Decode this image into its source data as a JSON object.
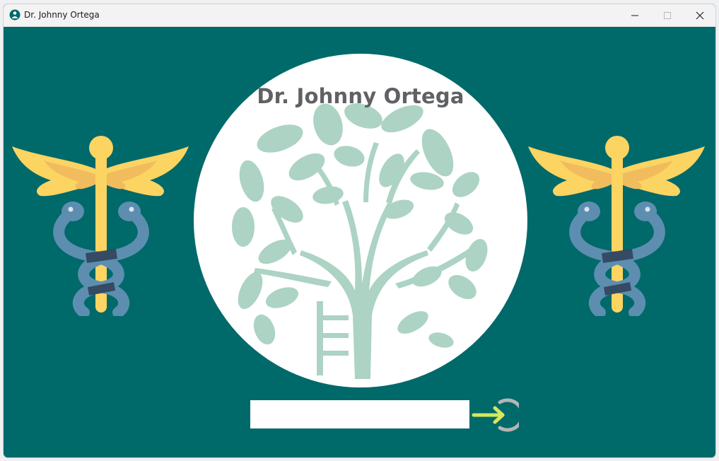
{
  "window": {
    "title": "Dr. Johnny Ortega",
    "controls": [
      "minimize",
      "maximize",
      "close"
    ]
  },
  "main": {
    "doctor_name": "Dr. Johnny Ortega",
    "password_field": {
      "value": "",
      "placeholder": ""
    },
    "login_button_icon": "arrow-right-circle-icon",
    "left_emblem_icon": "caduceus-icon",
    "right_emblem_icon": "caduceus-icon",
    "logo_icon": "tree-with-ladder-icon"
  },
  "colors": {
    "background": "#00696a",
    "circle": "#ffffff",
    "tree": "#acd3c4",
    "wings_outer": "#fcd462",
    "wings_inner": "#f0bc5e",
    "staff": "#fcd462",
    "snake": "#5d8eb0",
    "snake_shadow": "#2f3f56",
    "name_text": "#5f6164",
    "arrow": "#d6e85a",
    "ring": "#b5b5b5"
  }
}
